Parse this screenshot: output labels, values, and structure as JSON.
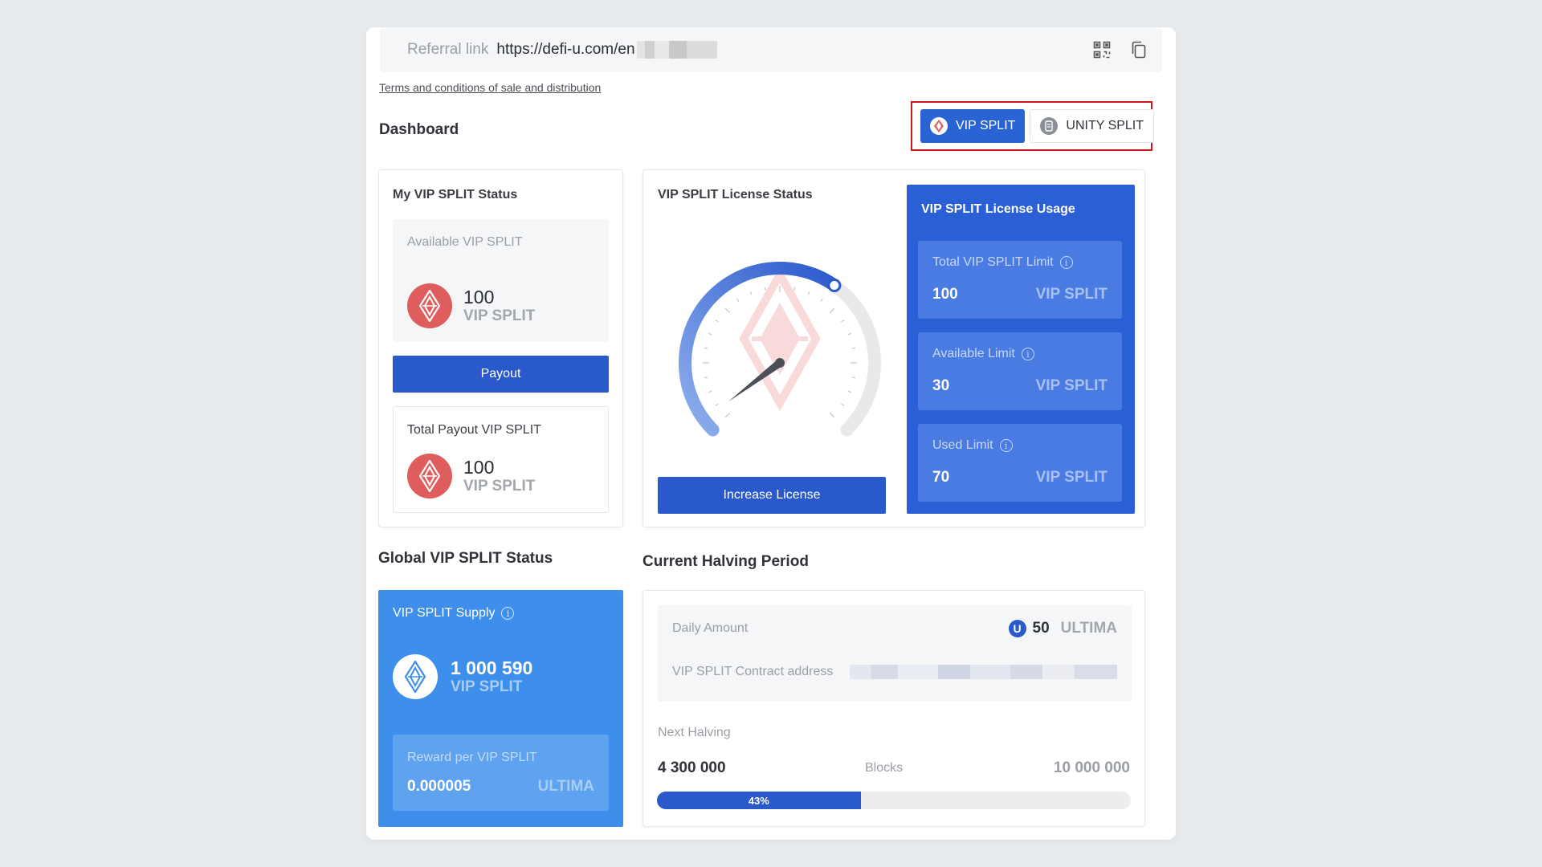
{
  "referral": {
    "label": "Referral link",
    "url": "https://defi-u.com/en"
  },
  "terms_link": "Terms and conditions of sale and distribution",
  "dashboard_title": "Dashboard",
  "switcher": {
    "vip_label": "VIP SPLIT",
    "unity_label": "UNITY SPLIT"
  },
  "my_status": {
    "title": "My VIP SPLIT Status",
    "available_label": "Available VIP SPLIT",
    "available_value": "100",
    "available_unit": "VIP SPLIT",
    "payout_button": "Payout",
    "total_label": "Total Payout VIP SPLIT",
    "total_value": "100",
    "total_unit": "VIP SPLIT"
  },
  "license_status": {
    "title": "VIP SPLIT License Status",
    "gauge_fraction": 0.3,
    "increase_button": "Increase License"
  },
  "license_usage": {
    "title": "VIP SPLIT License Usage",
    "items": [
      {
        "label": "Total VIP SPLIT Limit",
        "value": "100",
        "unit": "VIP SPLIT"
      },
      {
        "label": "Available Limit",
        "value": "30",
        "unit": "VIP SPLIT"
      },
      {
        "label": "Used Limit",
        "value": "70",
        "unit": "VIP SPLIT"
      }
    ]
  },
  "global": {
    "title": "Global VIP SPLIT Status",
    "supply_label": "VIP SPLIT Supply",
    "supply_value": "1 000 590",
    "supply_unit": "VIP SPLIT",
    "reward_label": "Reward per VIP SPLIT",
    "reward_value": "0.000005",
    "reward_unit": "ULTIMA"
  },
  "halving": {
    "title": "Current Halving Period",
    "daily_label": "Daily Amount",
    "daily_value": "50",
    "daily_unit": "ULTIMA",
    "contract_label": "VIP SPLIT Contract address",
    "next_label": "Next Halving",
    "current_blocks": "4 300 000",
    "blocks_label": "Blocks",
    "target_blocks": "10 000 000",
    "progress_percent": 43,
    "progress_label": "43%"
  },
  "colors": {
    "primary": "#2a59cc",
    "usage_panel": "#2a5fd6",
    "supply_card": "#3e8fec",
    "coin_red": "#e05d5d",
    "highlight_border": "#d0141b"
  }
}
